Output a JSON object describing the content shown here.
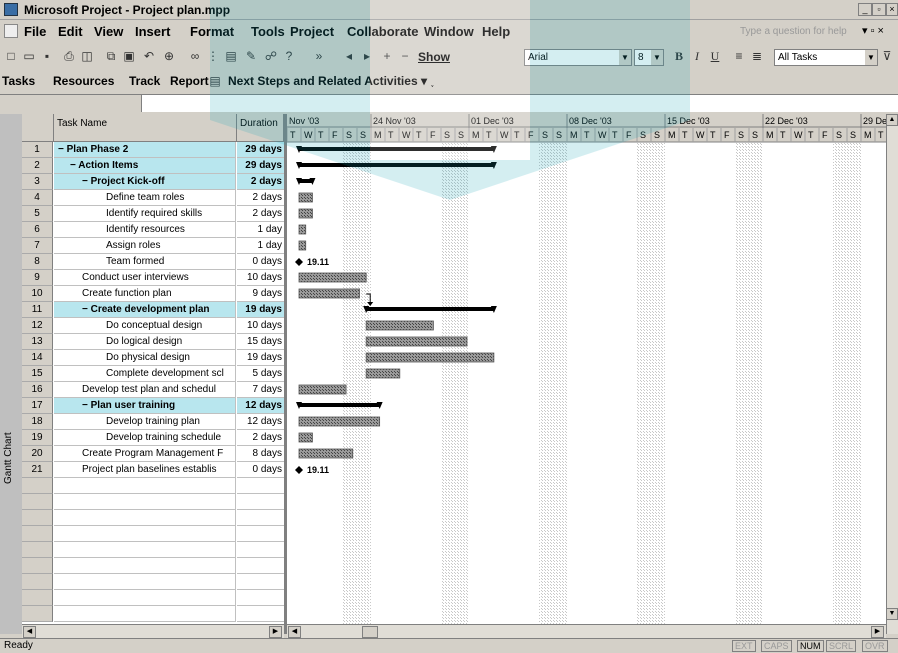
{
  "window": {
    "title": "Microsoft Project - Project plan.mpp"
  },
  "menu": [
    "File",
    "Edit",
    "View",
    "Insert",
    "Format",
    "Tools",
    "Project",
    "Collaborate",
    "Window",
    "Help"
  ],
  "help_placeholder": "Type a question for help",
  "toolbar": {
    "show_label": "Show",
    "font": "Arial",
    "size": "8",
    "filter": "All Tasks"
  },
  "guide": {
    "tasks": "Tasks",
    "resources": "Resources",
    "track": "Track",
    "report": "Report",
    "next_steps": "Next Steps and Related Activities"
  },
  "columns": {
    "name": "Task Name",
    "duration": "Duration"
  },
  "timescale": {
    "weeks": [
      "Nov '03",
      "24 Nov '03",
      "01 Dec '03",
      "08 Dec '03",
      "15 Dec '03",
      "22 Dec '03",
      "29 De"
    ],
    "days": [
      "T",
      "W",
      "T",
      "F",
      "S",
      "S",
      "M",
      "T",
      "W",
      "T",
      "F",
      "S",
      "S",
      "M",
      "T",
      "W",
      "T",
      "F",
      "S",
      "S",
      "M",
      "T",
      "W",
      "T",
      "F",
      "S",
      "S",
      "M",
      "T",
      "W",
      "T",
      "F",
      "S",
      "S",
      "M",
      "T",
      "W",
      "T",
      "F",
      "S",
      "S",
      "M",
      "T"
    ]
  },
  "tasks": [
    {
      "id": "1",
      "name": "Plan Phase 2",
      "duration": "29 days",
      "indent": 0,
      "summary": true,
      "outline": "−"
    },
    {
      "id": "2",
      "name": "Action Items",
      "duration": "29 days",
      "indent": 1,
      "summary": true,
      "outline": "−"
    },
    {
      "id": "3",
      "name": "Project Kick-off",
      "duration": "2 days",
      "indent": 2,
      "summary": true,
      "outline": "−"
    },
    {
      "id": "4",
      "name": "Define team roles",
      "duration": "2 days",
      "indent": 3
    },
    {
      "id": "5",
      "name": "Identify required skills",
      "duration": "2 days",
      "indent": 3
    },
    {
      "id": "6",
      "name": "Identify resources",
      "duration": "1 day",
      "indent": 3
    },
    {
      "id": "7",
      "name": "Assign roles",
      "duration": "1 day",
      "indent": 3
    },
    {
      "id": "8",
      "name": "Team formed",
      "duration": "0 days",
      "indent": 3,
      "milestone": "19.11"
    },
    {
      "id": "9",
      "name": "Conduct user interviews",
      "duration": "10 days",
      "indent": 2
    },
    {
      "id": "10",
      "name": "Create function plan",
      "duration": "9 days",
      "indent": 2
    },
    {
      "id": "11",
      "name": "Create development plan",
      "duration": "19 days",
      "indent": 2,
      "summary": true,
      "outline": "−"
    },
    {
      "id": "12",
      "name": "Do conceptual design",
      "duration": "10 days",
      "indent": 3
    },
    {
      "id": "13",
      "name": "Do logical design",
      "duration": "15 days",
      "indent": 3
    },
    {
      "id": "14",
      "name": "Do physical design",
      "duration": "19 days",
      "indent": 3
    },
    {
      "id": "15",
      "name": "Complete development scl",
      "duration": "5 days",
      "indent": 3
    },
    {
      "id": "16",
      "name": "Develop test plan and schedul",
      "duration": "7 days",
      "indent": 2
    },
    {
      "id": "17",
      "name": "Plan user training",
      "duration": "12 days",
      "indent": 2,
      "summary": true,
      "outline": "−"
    },
    {
      "id": "18",
      "name": "Develop training plan",
      "duration": "12 days",
      "indent": 3
    },
    {
      "id": "19",
      "name": "Develop training schedule",
      "duration": "2 days",
      "indent": 3
    },
    {
      "id": "20",
      "name": "Create Program Management F",
      "duration": "8 days",
      "indent": 2
    },
    {
      "id": "21",
      "name": "Project plan baselines establis",
      "duration": "0 days",
      "indent": 2,
      "milestone": "19.11"
    }
  ],
  "gantt": [
    {
      "row": 0,
      "start": 0,
      "end": 29,
      "type": "summary"
    },
    {
      "row": 1,
      "start": 0,
      "end": 29,
      "type": "summary"
    },
    {
      "row": 2,
      "start": 0,
      "end": 2,
      "type": "summary"
    },
    {
      "row": 3,
      "start": 0,
      "end": 2,
      "type": "task"
    },
    {
      "row": 4,
      "start": 0,
      "end": 2,
      "type": "task"
    },
    {
      "row": 5,
      "start": 0,
      "end": 1,
      "type": "task"
    },
    {
      "row": 6,
      "start": 0,
      "end": 1,
      "type": "task"
    },
    {
      "row": 7,
      "start": 0,
      "end": 0,
      "type": "milestone"
    },
    {
      "row": 8,
      "start": 0,
      "end": 10,
      "type": "task"
    },
    {
      "row": 9,
      "start": 0,
      "end": 9,
      "type": "task"
    },
    {
      "row": 10,
      "start": 10,
      "end": 29,
      "type": "summary"
    },
    {
      "row": 11,
      "start": 10,
      "end": 20,
      "type": "task"
    },
    {
      "row": 12,
      "start": 10,
      "end": 25,
      "type": "task"
    },
    {
      "row": 13,
      "start": 10,
      "end": 29,
      "type": "task"
    },
    {
      "row": 14,
      "start": 10,
      "end": 15,
      "type": "task"
    },
    {
      "row": 15,
      "start": 0,
      "end": 7,
      "type": "task"
    },
    {
      "row": 16,
      "start": 0,
      "end": 12,
      "type": "summary"
    },
    {
      "row": 17,
      "start": 0,
      "end": 12,
      "type": "task"
    },
    {
      "row": 18,
      "start": 0,
      "end": 2,
      "type": "task"
    },
    {
      "row": 19,
      "start": 0,
      "end": 8,
      "type": "task"
    },
    {
      "row": 20,
      "start": 0,
      "end": 0,
      "type": "milestone"
    }
  ],
  "sidebar_label": "Gantt Chart",
  "status": {
    "text": "Ready",
    "indicators": [
      {
        "label": "EXT",
        "on": false
      },
      {
        "label": "CAPS",
        "on": false
      },
      {
        "label": "NUM",
        "on": true
      },
      {
        "label": "SCRL",
        "on": false
      },
      {
        "label": "OVR",
        "on": false
      }
    ]
  }
}
